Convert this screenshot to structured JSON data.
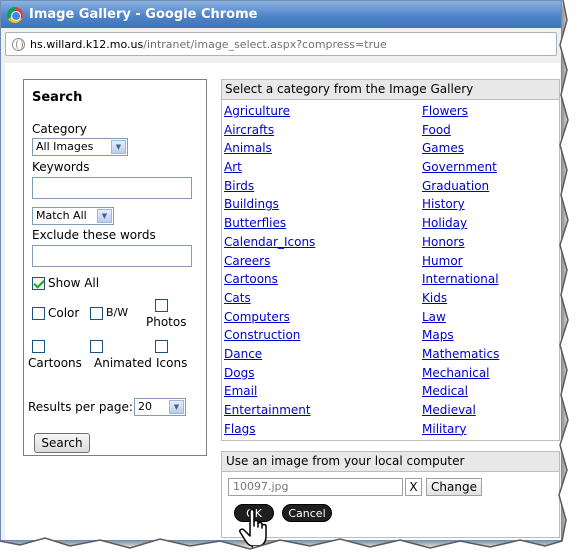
{
  "window": {
    "title": "Image Gallery - Google Chrome"
  },
  "address_bar": {
    "host": "hs.willard.k12.mo.us",
    "path": "/intranet/image_select.aspx?compress=true"
  },
  "search": {
    "title": "Search",
    "category_label": "Category",
    "category_value": "All Images",
    "keywords_label": "Keywords",
    "keywords_value": "",
    "match_value": "Match All",
    "exclude_label": "Exclude these words",
    "exclude_value": "",
    "show_all_label": "Show All",
    "show_all_checked": true,
    "color_label": "Color",
    "bw_label": "B/W",
    "photos_label": "Photos",
    "cartoons_label": "Cartoons",
    "animated_label": "Animated",
    "icons_label": "Icons",
    "results_label": "Results per page:",
    "results_value": "20",
    "search_button": "Search"
  },
  "gallery": {
    "header": "Select a category from the Image Gallery",
    "left_categories": [
      "Agriculture",
      "Aircrafts",
      "Animals",
      "Art",
      "Birds",
      "Buildings",
      "Butterflies",
      "Calendar_Icons",
      "Careers",
      "Cartoons",
      "Cats",
      "Computers",
      "Construction",
      "Dance",
      "Dogs",
      "Email",
      "Entertainment",
      "Flags"
    ],
    "right_categories": [
      "Flowers",
      "Food",
      "Games",
      "Government",
      "Graduation",
      "History",
      "Holiday",
      "Honors",
      "Humor",
      "International",
      "Kids",
      "Law",
      "Maps",
      "Mathematics",
      "Mechanical",
      "Medical",
      "Medieval",
      "Military"
    ]
  },
  "local_image": {
    "header": "Use an image from your local computer",
    "file_value": "10097.jpg",
    "clear_label": "X",
    "change_button": "Change",
    "ok_button": "OK",
    "cancel_button": "Cancel"
  }
}
